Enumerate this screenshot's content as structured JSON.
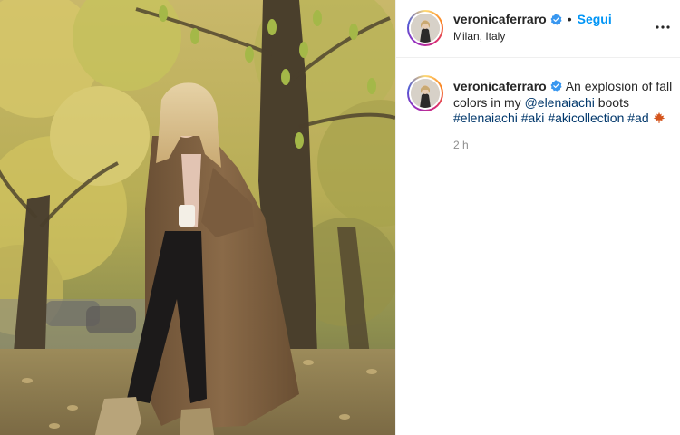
{
  "post": {
    "photo_alt": "",
    "author": {
      "username": "veronicaferraro",
      "verified": true,
      "follow_label": "Segui",
      "separator": "•",
      "location": "Milan, Italy",
      "avatar_icon": "profile-photo"
    },
    "more_icon": "more-options-icon",
    "caption": {
      "username": "veronicaferraro",
      "text_before": "An explosion of fall colors in my ",
      "mention": "@elenaiachi",
      "text_after": " boots",
      "hashtags": [
        "#elenaiachi",
        "#aki",
        "#akicollection",
        "#ad"
      ],
      "emoji": "maple-leaf",
      "time": "2 h"
    }
  },
  "colors": {
    "link_blue": "#0095f6",
    "tag_blue": "#00376b",
    "text": "#262626",
    "muted": "#8e8e8e",
    "divider": "#efefef"
  }
}
